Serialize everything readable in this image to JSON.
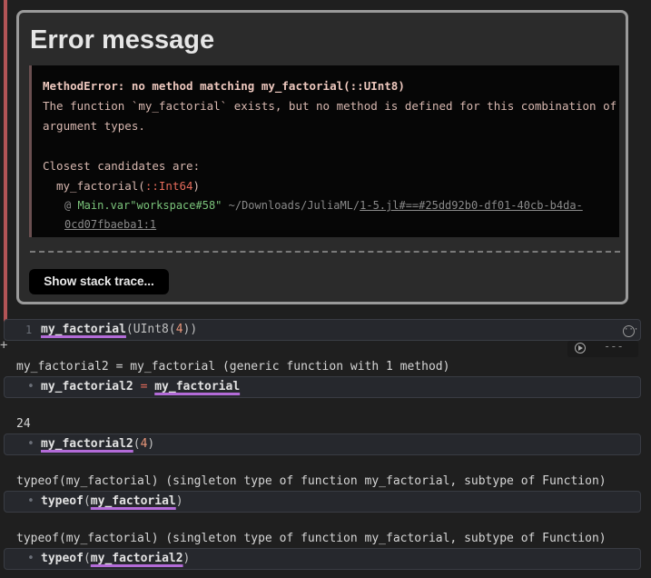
{
  "error": {
    "title": "Error message",
    "header_label": "MethodError: no method matching my_factorial(::UInt8)",
    "desc_line1": "The function `my_factorial` exists, but no method is defined for this combination of",
    "desc_line2": "argument types.",
    "candidates_label": "Closest candidates are:",
    "candidate_name": "my_factorial(",
    "candidate_type": "::Int64",
    "candidate_close": ")",
    "candidate_at": "@ ",
    "candidate_module": "Main.var\"workspace#58\"",
    "candidate_path": " ~/Downloads/JuliaML/",
    "candidate_link1": "1-5.jl#==#25dd92b0-df01-40cb-b4da-",
    "candidate_link2": "0cd07fbaeba1:1",
    "stack_button": "Show stack trace..."
  },
  "cells": [
    {
      "line_no": "1",
      "fn": "my_factorial",
      "rest_open": "(UInt8(",
      "arg": "4",
      "rest_close": "))"
    },
    {
      "output": "my_factorial2 = my_factorial (generic function with 1 method)",
      "bullet": "•",
      "lhs": "my_factorial2",
      "op": " = ",
      "rhs": "my_factorial"
    },
    {
      "output": "24",
      "bullet": "•",
      "fn": "my_factorial2",
      "open": "(",
      "arg": "4",
      "close": ")"
    },
    {
      "output": "typeof(my_factorial) (singleton type of function my_factorial, subtype of Function)",
      "bullet": "•",
      "kw": "typeof",
      "open": "(",
      "fn": "my_factorial",
      "close": ")"
    },
    {
      "output": "typeof(my_factorial) (singleton type of function my_factorial, subtype of Function)",
      "bullet": "•",
      "kw": "typeof",
      "open": "(",
      "fn": "my_factorial2",
      "close": ")"
    }
  ],
  "toolbar": {
    "menu_icon": "ellipsis-circle-icon",
    "add_icon": "plus-icon",
    "run_icon": "run-cell-icon",
    "run_dashes": "---"
  }
}
